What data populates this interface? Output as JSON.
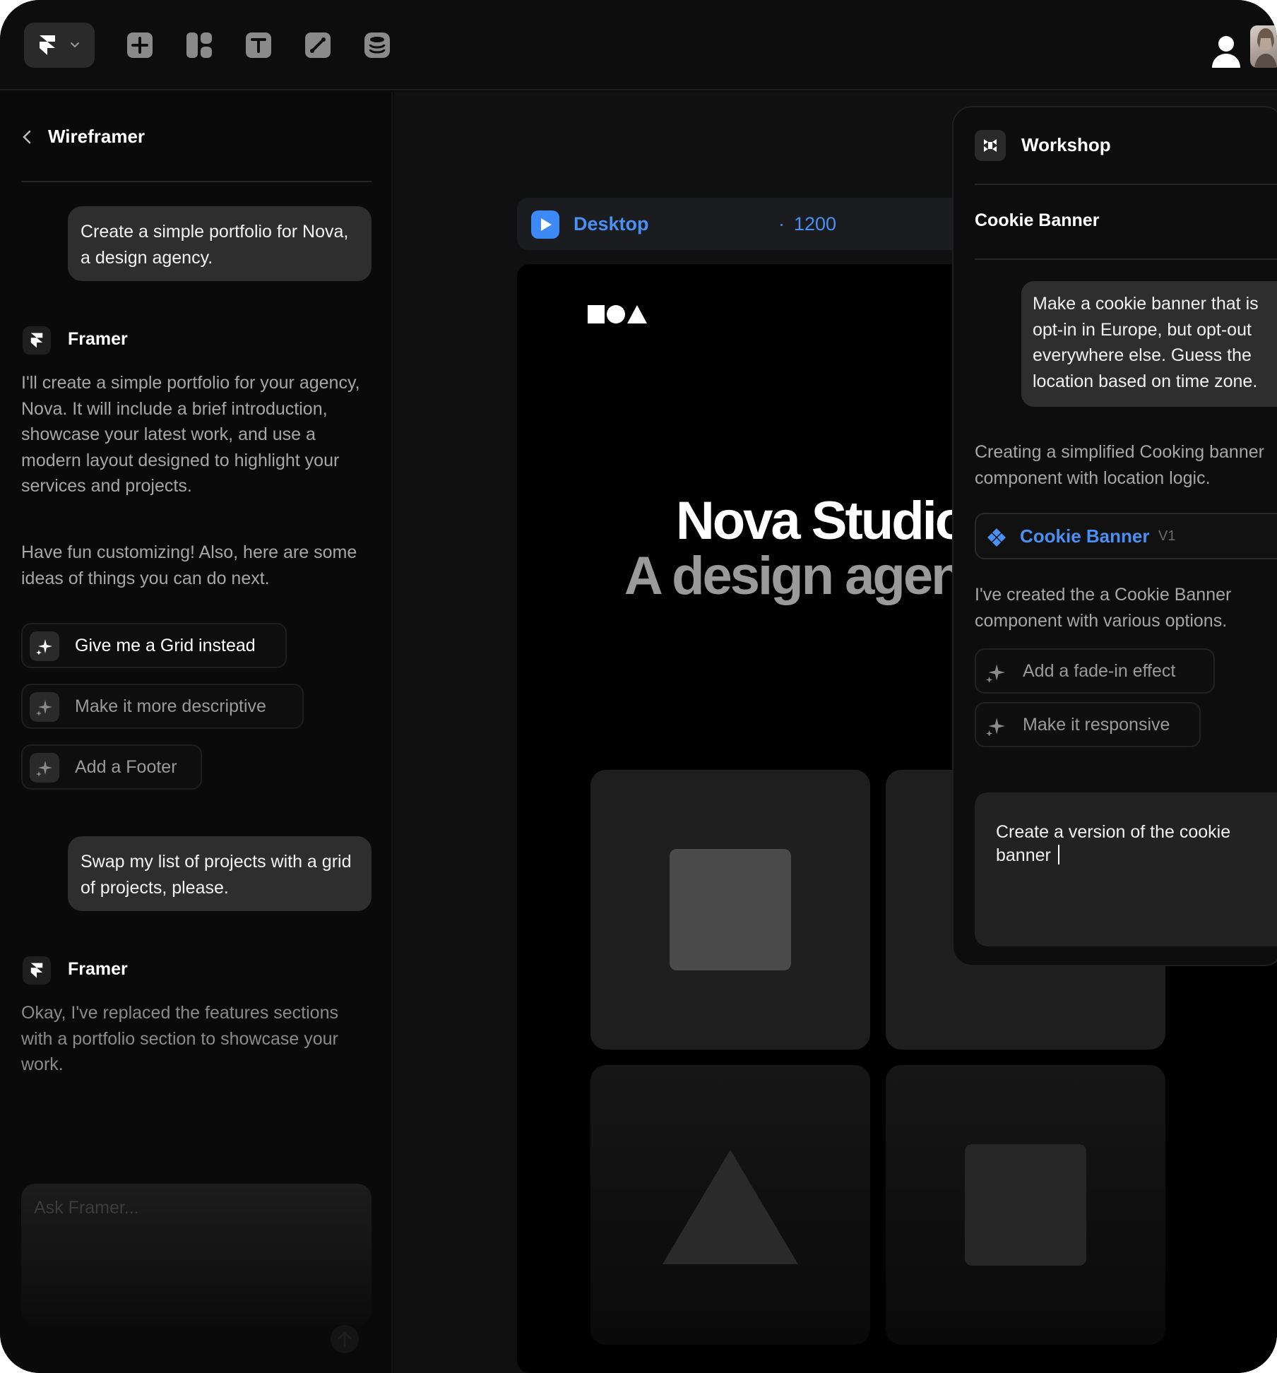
{
  "toolbar": {
    "tools": [
      "plus-square-icon",
      "layout-icon",
      "text-icon",
      "link-icon",
      "database-icon"
    ]
  },
  "sidebar": {
    "title": "Wireframer",
    "messages": [
      {
        "role": "user",
        "text": "Create a simple portfolio for Nova, a design agency."
      },
      {
        "role": "assistant",
        "name": "Framer",
        "paragraphs": [
          "I'll create a simple portfolio for your agency, Nova. It will include a brief introduction, showcase your latest work, and use a modern layout designed to highlight your services and projects.",
          "Have fun customizing! Also, here are some ideas of things you can do next."
        ]
      },
      {
        "role": "user",
        "text": "Swap my list of projects with a grid of projects, please."
      },
      {
        "role": "assistant",
        "name": "Framer",
        "paragraphs": [
          "Okay, I've replaced the features sections with a portfolio section to showcase your work."
        ]
      }
    ],
    "suggestions": [
      "Give me a Grid instead",
      "Make it more descriptive",
      "Add a Footer"
    ],
    "ask_placeholder": "Ask Framer..."
  },
  "canvas": {
    "frame_name": "Desktop",
    "separator": "·",
    "frame_width": "1200",
    "hero_line1": "Nova Studio",
    "hero_line2": "A design agency"
  },
  "workshop": {
    "title": "Workshop",
    "component_title": "Cookie Banner",
    "user_message_lines": [
      "Make a cookie banner that is",
      "opt-in in Europe, but opt-out",
      "everywhere else. Guess the",
      "location based on time zone."
    ],
    "reply1_lines": [
      "Creating a simplified Cooking banner",
      "component with location logic."
    ],
    "chip_name": "Cookie Banner",
    "chip_version": "V1",
    "reply2_lines": [
      "I've created the a Cookie Banner",
      "component with various options."
    ],
    "suggestions": [
      "Add a fade-in effect",
      "Make it responsive"
    ],
    "input_text": "Create a version of the cookie banner"
  },
  "colors": {
    "accent": "#4a90f2",
    "background": "#0b0b0b",
    "bubble": "#2e2e2e"
  }
}
